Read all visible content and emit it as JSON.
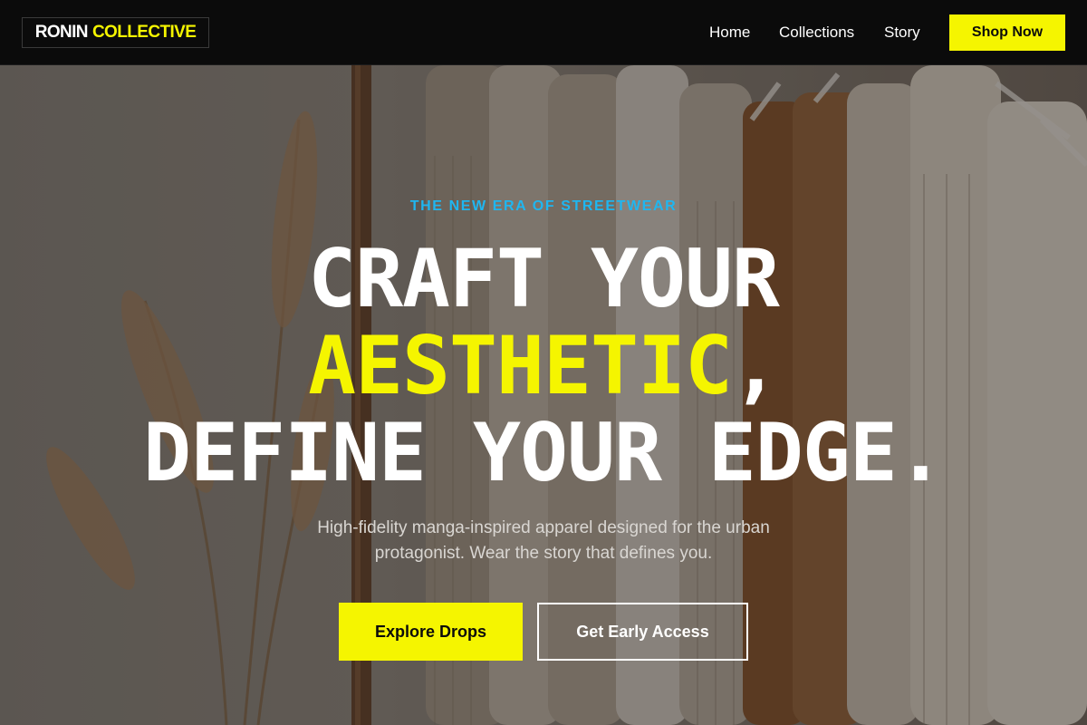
{
  "brand": {
    "part1": "RONIN",
    "part2": "COLLECTIVE"
  },
  "nav": {
    "links": [
      "Home",
      "Collections",
      "Story"
    ],
    "cta": "Shop Now"
  },
  "hero": {
    "eyebrow": "THE NEW ERA OF STREETWEAR",
    "headline": {
      "line1": "CRAFT YOUR",
      "line2_accent": "AESTHETIC",
      "line2_suffix": ",",
      "line3": "DEFINE YOUR EDGE."
    },
    "subtitle": "High-fidelity manga-inspired apparel designed for the urban protagonist. Wear the story that defines you.",
    "primary_button": "Explore Drops",
    "secondary_button": "Get Early Access"
  },
  "colors": {
    "accent_yellow": "#f5f500",
    "eyebrow_blue": "#1fb6f0",
    "nav_bg": "#0b0b0b"
  }
}
